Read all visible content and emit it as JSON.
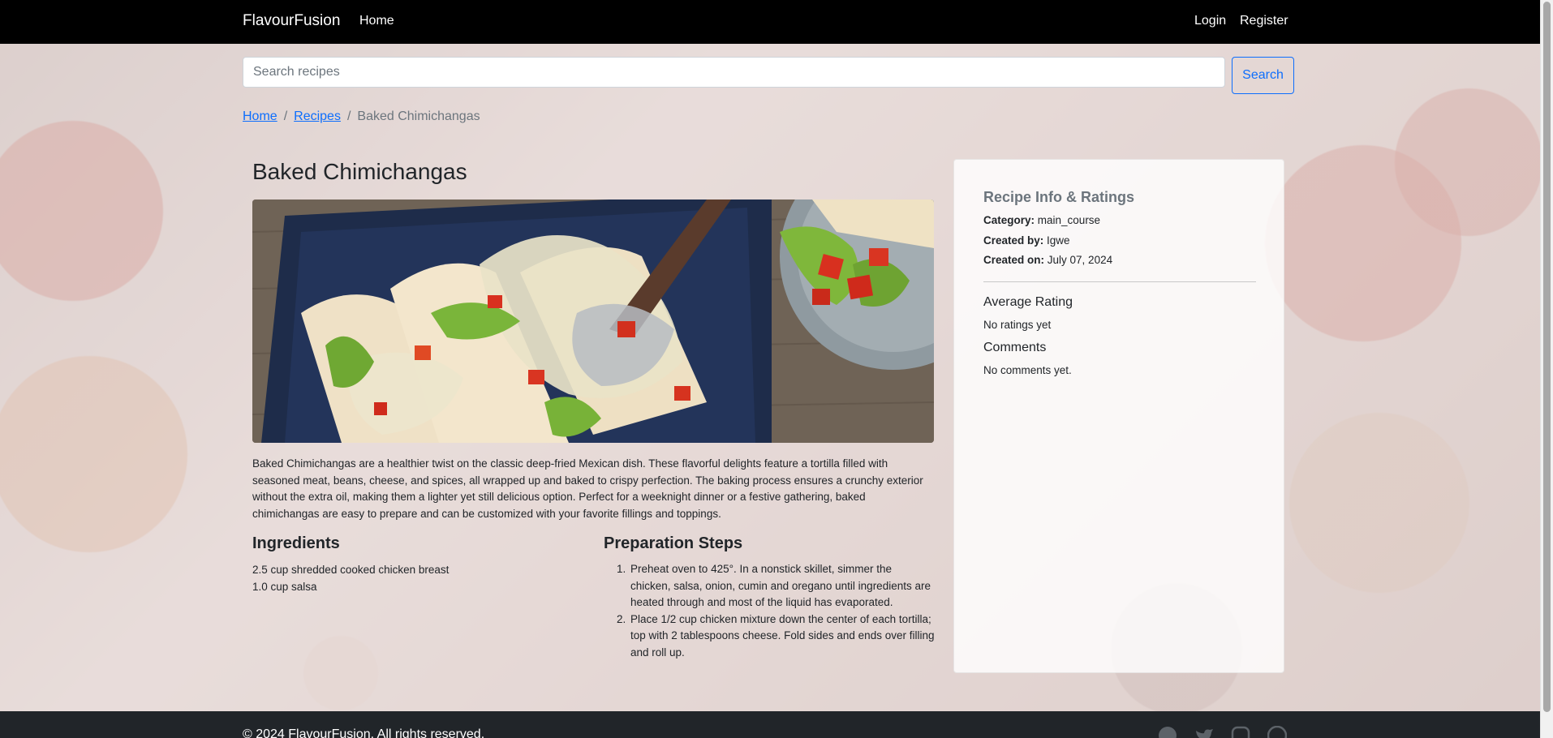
{
  "navbar": {
    "brand": "FlavourFusion",
    "home": "Home",
    "login": "Login",
    "register": "Register"
  },
  "search": {
    "placeholder": "Search recipes",
    "button": "Search"
  },
  "breadcrumb": {
    "home": "Home",
    "recipes": "Recipes",
    "current": "Baked Chimichangas",
    "separator": "/"
  },
  "recipe": {
    "title": "Baked Chimichangas",
    "description": "Baked Chimichangas are a healthier twist on the classic deep-fried Mexican dish. These flavorful delights feature a tortilla filled with seasoned meat, beans, cheese, and spices, all wrapped up and baked to crispy perfection. The baking process ensures a crunchy exterior without the extra oil, making them a lighter yet still delicious option. Perfect for a weeknight dinner or a festive gathering, baked chimichangas are easy to prepare and can be customized with your favorite fillings and toppings.",
    "ingredients_heading": "Ingredients",
    "ingredients": [
      "2.5 cup shredded cooked chicken breast",
      "1.0 cup salsa"
    ],
    "steps_heading": "Preparation Steps",
    "steps": [
      "Preheat oven to 425°. In a nonstick skillet, simmer the chicken, salsa, onion, cumin and oregano until ingredients are heated through and most of the liquid has evaporated.",
      "Place 1/2 cup chicken mixture down the center of each tortilla; top with 2 tablespoons cheese. Fold sides and ends over filling and roll up."
    ]
  },
  "info": {
    "title": "Recipe Info & Ratings",
    "category_label": "Category:",
    "category": "main_course",
    "created_by_label": "Created by:",
    "created_by": "Igwe",
    "created_on_label": "Created on:",
    "created_on": "July 07, 2024",
    "avg_rating_heading": "Average Rating",
    "avg_rating_text": "No ratings yet",
    "comments_heading": "Comments",
    "comments_text": "No comments yet."
  },
  "footer": {
    "copyright": "© 2024 FlavourFusion. All rights reserved.",
    "social_icons": [
      "facebook-icon",
      "twitter-icon",
      "instagram-icon",
      "pinterest-icon"
    ]
  },
  "colors": {
    "navbar": "#000000",
    "link": "#0d6efd",
    "footer": "#212529"
  }
}
